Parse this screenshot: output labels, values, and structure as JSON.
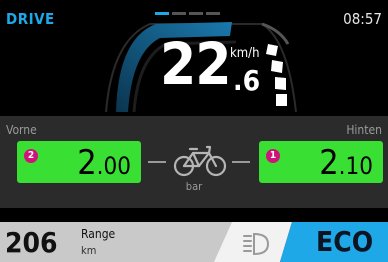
{
  "header": {
    "mode": "DRIVE",
    "time": "08:57",
    "pages": {
      "count": 4,
      "active_index": 0
    }
  },
  "speed": {
    "integer": "22",
    "decimal": ".6",
    "unit": "km/h"
  },
  "tire_pressure": {
    "front": {
      "label": "Vorne",
      "sensor": "2",
      "integer": "2",
      "decimal": ".00"
    },
    "rear": {
      "label": "Hinten",
      "sensor": "1",
      "integer": "2",
      "decimal": ".10"
    },
    "unit": "bar",
    "icon": "bicycle-icon"
  },
  "footer": {
    "range_value": "206",
    "range_label": "Range",
    "range_unit": "km",
    "light_icon": "headlight-icon",
    "assist_mode": "ECO"
  },
  "colors": {
    "accent_blue": "#1ea8e8",
    "pressure_ok_green": "#39e033",
    "sensor_badge": "#d0137a",
    "panel_gray": "#2b2b2b",
    "range_panel": "#c9c9c9"
  }
}
